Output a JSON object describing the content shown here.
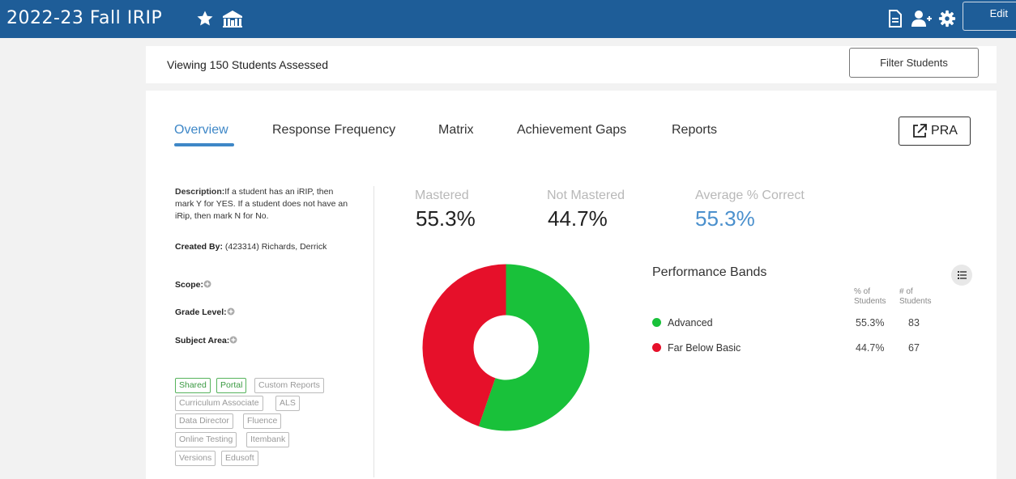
{
  "header": {
    "title": "2022-23 Fall IRIP",
    "edit_label": "Edit"
  },
  "viewing": {
    "label": "Viewing 150 Students Assessed",
    "filter_button": "Filter Students"
  },
  "tabs": [
    {
      "label": "Overview",
      "active": true
    },
    {
      "label": "Response Frequency",
      "active": false
    },
    {
      "label": "Matrix",
      "active": false
    },
    {
      "label": "Achievement Gaps",
      "active": false
    },
    {
      "label": "Reports",
      "active": false
    }
  ],
  "pra_button": "PRA",
  "info": {
    "description_label": "Description:",
    "description_text": "If a student has an iRIP, then mark Y for YES. If a student does not have an iRip, then mark N for No.",
    "created_by_label": "Created By:",
    "created_by_value": "(423314) Richards, Derrick",
    "scope_label": "Scope:",
    "grade_level_label": "Grade Level:",
    "subject_area_label": "Subject Area:"
  },
  "tags": [
    {
      "label": "Shared",
      "active": true
    },
    {
      "label": "Portal",
      "active": true
    },
    {
      "label": "Custom Reports",
      "active": false
    },
    {
      "label": "Curriculum Associate",
      "active": false
    },
    {
      "label": "ALS",
      "active": false
    },
    {
      "label": "Data Director",
      "active": false
    },
    {
      "label": "Fluence",
      "active": false
    },
    {
      "label": "Online Testing",
      "active": false
    },
    {
      "label": "Itembank",
      "active": false
    },
    {
      "label": "Versions",
      "active": false
    },
    {
      "label": "Edusoft",
      "active": false
    }
  ],
  "stats": {
    "mastered_label": "Mastered",
    "mastered_value": "55.3%",
    "not_mastered_label": "Not Mastered",
    "not_mastered_value": "44.7%",
    "avg_label": "Average % Correct",
    "avg_value": "55.3%"
  },
  "performance_bands": {
    "title": "Performance Bands",
    "col_pct": "% of Students",
    "col_count": "# of Students",
    "bands": [
      {
        "name": "Advanced",
        "pct": "55.3%",
        "count": "83",
        "color": "#19c13a",
        "fraction": 0.553
      },
      {
        "name": "Far Below Basic",
        "pct": "44.7%",
        "count": "67",
        "color": "#e6102a",
        "fraction": 0.447
      }
    ]
  },
  "colors": {
    "header_blue": "#1e5d98",
    "accent_blue": "#3e87c7"
  }
}
